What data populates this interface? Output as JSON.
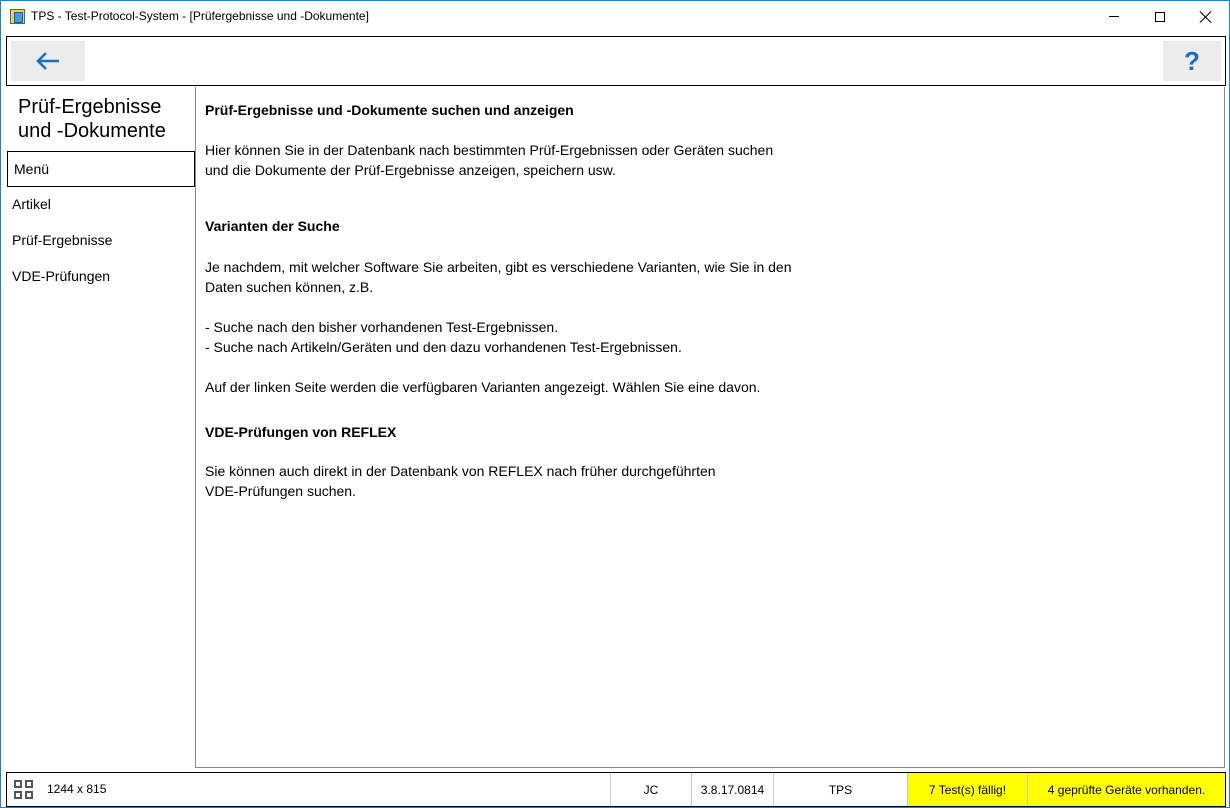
{
  "window": {
    "title": "TPS - Test-Protocol-System - [Prüfergebnisse und -Dokumente]"
  },
  "toolbar": {
    "back_icon": "arrow-left-icon",
    "help_label": "?"
  },
  "sidebar": {
    "title": "Prüf-Ergebnisse und -Dokumente",
    "items": [
      {
        "label": "Menü",
        "active": true
      },
      {
        "label": "Artikel",
        "active": false
      },
      {
        "label": "Prüf-Ergebnisse",
        "active": false
      },
      {
        "label": "VDE-Prüfungen",
        "active": false
      }
    ]
  },
  "content": {
    "heading1": "Prüf-Ergebnisse und -Dokumente suchen und anzeigen",
    "intro_line1": "Hier können Sie in der Datenbank nach bestimmten Prüf-Ergebnissen oder Geräten suchen",
    "intro_line2": "und die Dokumente der Prüf-Ergebnisse anzeigen, speichern usw.",
    "heading2": "Varianten der Suche",
    "variants_line1": "Je nachdem, mit welcher Software Sie arbeiten, gibt es verschiedene Varianten, wie Sie in den",
    "variants_line2": "Daten suchen können, z.B.",
    "bullet1": "- Suche nach den bisher vorhandenen Test-Ergebnissen.",
    "bullet2": "- Suche nach Artikeln/Geräten und den dazu vorhandenen Test-Ergebnissen.",
    "choose_line": "Auf der linken Seite werden die verfügbaren Varianten angezeigt. Wählen Sie eine davon.",
    "heading3": "VDE-Prüfungen von REFLEX",
    "reflex_line1": "Sie können auch direkt in der Datenbank von REFLEX nach früher durchgeführten",
    "reflex_line2": "VDE-Prüfungen suchen."
  },
  "statusbar": {
    "size": "1244 x 815",
    "user": "JC",
    "version": "3.8.17.0814",
    "app": "TPS",
    "tests_due": "7 Test(s) fällig!",
    "devices": "4 geprüfte Geräte vorhanden.",
    "warn_color": "#ffff00"
  }
}
